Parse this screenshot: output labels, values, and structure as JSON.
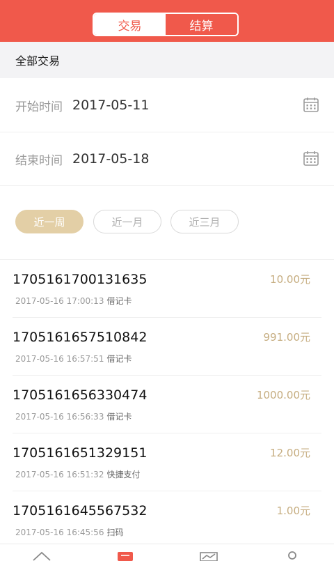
{
  "header": {
    "tabs": [
      {
        "label": "交易",
        "active": true
      },
      {
        "label": "结算",
        "active": false
      }
    ],
    "accent_color": "#f0594b"
  },
  "filter": {
    "label": "全部交易"
  },
  "date_range": {
    "start": {
      "label": "开始时间",
      "value": "2017-05-11"
    },
    "end": {
      "label": "结束时间",
      "value": "2017-05-18"
    }
  },
  "quick_range": [
    {
      "label": "近一周",
      "selected": true
    },
    {
      "label": "近一月",
      "selected": false
    },
    {
      "label": "近三月",
      "selected": false
    }
  ],
  "transactions": [
    {
      "id": "1705161700131635",
      "amount": "10.00元",
      "time": "2017-05-16 17:00:13",
      "type": "借记卡"
    },
    {
      "id": "1705161657510842",
      "amount": "991.00元",
      "time": "2017-05-16 16:57:51",
      "type": "借记卡"
    },
    {
      "id": "1705161656330474",
      "amount": "1000.00元",
      "time": "2017-05-16 16:56:33",
      "type": "借记卡"
    },
    {
      "id": "1705161651329151",
      "amount": "12.00元",
      "time": "2017-05-16 16:51:32",
      "type": "快捷支付"
    },
    {
      "id": "1705161645567532",
      "amount": "1.00元",
      "time": "2017-05-16 16:45:56",
      "type": "扫码"
    }
  ],
  "tabbar": {
    "items": [
      {
        "icon": "home-icon"
      },
      {
        "icon": "list-icon",
        "active": true
      },
      {
        "icon": "chart-icon"
      },
      {
        "icon": "user-icon"
      }
    ]
  }
}
